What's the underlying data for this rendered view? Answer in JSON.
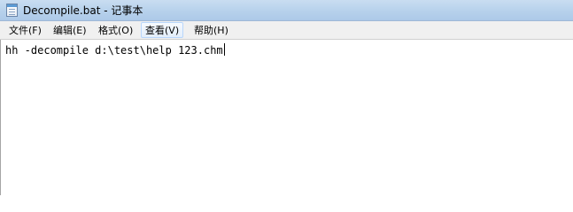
{
  "window": {
    "title": "Decompile.bat - 记事本"
  },
  "menu": {
    "items": [
      {
        "label": "文件(F)"
      },
      {
        "label": "编辑(E)"
      },
      {
        "label": "格式(O)"
      },
      {
        "label": "查看(V)"
      },
      {
        "label": "帮助(H)"
      }
    ]
  },
  "editor": {
    "text": "hh -decompile d:\\test\\help 123.chm"
  },
  "icons": {
    "app": "notepad-icon"
  }
}
